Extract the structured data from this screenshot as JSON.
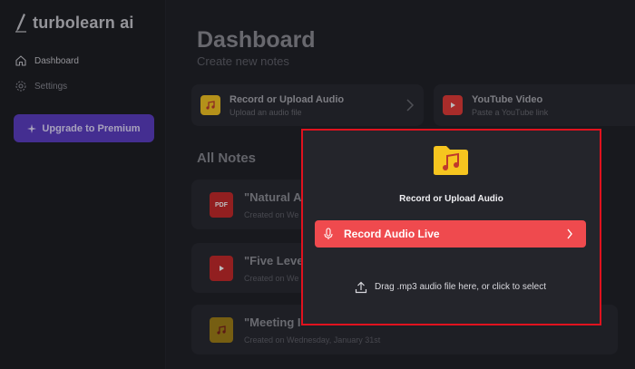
{
  "brand": {
    "name": "turbolearn ai"
  },
  "sidebar": {
    "items": [
      {
        "label": "Dashboard",
        "icon": "home-icon"
      },
      {
        "label": "Settings",
        "icon": "gear-icon"
      }
    ],
    "upgrade_label": "Upgrade to Premium"
  },
  "main": {
    "title": "Dashboard",
    "subtitle": "Create new notes",
    "cards": [
      {
        "title": "Record or Upload Audio",
        "desc": "Upload an audio file",
        "icon": "folder-music-icon"
      },
      {
        "title": "YouTube Video",
        "desc": "Paste a YouTube link",
        "icon": "youtube-icon"
      }
    ],
    "notes_title": "All Notes",
    "notes": [
      {
        "title": "\"Natural A",
        "date": "Created on We",
        "icon": "pdf-icon"
      },
      {
        "title": "\"Five Leve",
        "date": "Created on We",
        "icon": "youtube-icon"
      },
      {
        "title": "\"Meeting I",
        "date": "Created on Wednesday, January 31st",
        "icon": "folder-music-icon"
      }
    ]
  },
  "modal": {
    "title": "Record or Upload Audio",
    "record_label": "Record Audio Live",
    "drop_label": "Drag .mp3 audio file here, or click to select",
    "border_color": "#e0121e"
  },
  "colors": {
    "background": "#1e1f25",
    "accent_purple": "#5b3cc4",
    "record_red": "#ef4a4e",
    "folder_yellow": "#f6c51f"
  }
}
